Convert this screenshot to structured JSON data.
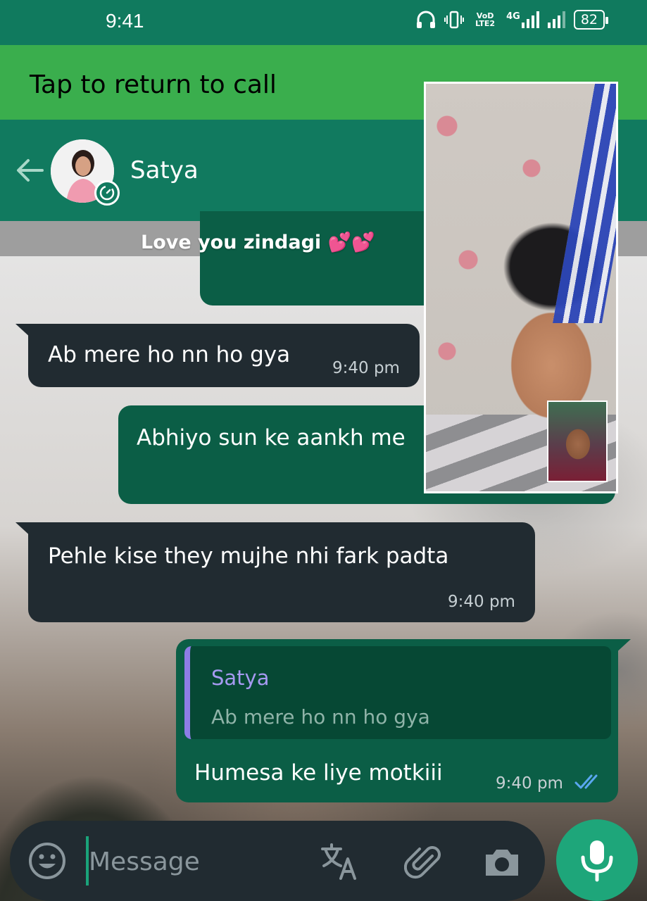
{
  "status_bar": {
    "time": "9:41",
    "network_label": "VoD LTE2",
    "network_type": "4G",
    "battery": "82"
  },
  "call_bar": {
    "label": "Tap to return to call"
  },
  "header": {
    "contact_name": "Satya"
  },
  "caption": {
    "text": "Love you zindagi 💕💕"
  },
  "messages": [
    {
      "direction": "incoming",
      "text": "Ab mere ho nn ho gya",
      "time": "9:40 pm"
    },
    {
      "direction": "outgoing",
      "text": "Abhiyo sun ke aankh me"
    },
    {
      "direction": "incoming",
      "text": "Pehle kise they mujhe nhi fark padta",
      "time": "9:40 pm"
    },
    {
      "direction": "outgoing",
      "reply_to": {
        "name": "Satya",
        "text": "Ab mere ho nn ho gya"
      },
      "text": "Humesa ke liye motkiii",
      "time": "9:40 pm",
      "status": "read"
    }
  ],
  "composer": {
    "placeholder": "Message"
  },
  "colors": {
    "header": "#117a5f",
    "call_bar": "#3aae4d",
    "outgoing_bubble": "#0b5e46",
    "incoming_bubble": "#212b31",
    "accent": "#1ea67a",
    "read_ticks": "#5aa7f0"
  },
  "icons": [
    "back-icon",
    "emoji-icon",
    "translate-icon",
    "attach-icon",
    "camera-icon",
    "mic-icon",
    "double-check-icon"
  ]
}
